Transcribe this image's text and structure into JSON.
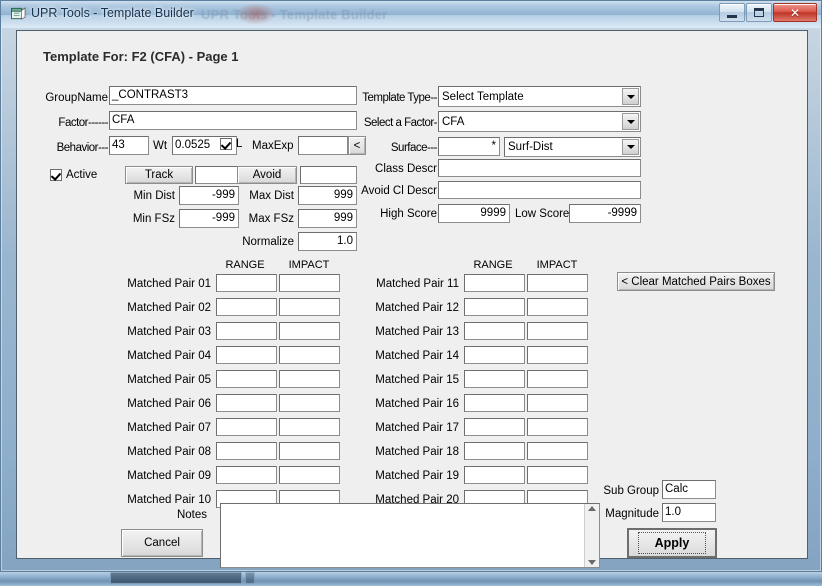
{
  "window": {
    "title": "UPR Tools - Template Builder",
    "icon": "app-window-icon",
    "ghost_title": "UPR Tools - Template Builder",
    "buttons": {
      "minimize": "minimize-icon",
      "maximize": "maximize-icon",
      "close": "✕"
    }
  },
  "page_title": "Template For: F2 (CFA) - Page 1",
  "left_panel": {
    "groupname_label": "GroupName",
    "groupname_value": "_CONTRAST3",
    "factor_label": "Factor------",
    "factor_value": "CFA",
    "behavior_label": "Behavior---",
    "behavior_value": "43",
    "wt_label": "Wt",
    "wt_value": "0.0525",
    "l_checkbox_checked": true,
    "l_label": "L",
    "maxexp_label": "MaxExp",
    "maxexp_value": "",
    "maxexp_button": "<",
    "active_label": "Active",
    "active_checked": true,
    "track_button": "Track",
    "track_value": "",
    "min_dist_label": "Min Dist",
    "min_dist_value": "-999",
    "min_fsz_label": "Min FSz",
    "min_fsz_value": "-999",
    "avoid_button": "Avoid",
    "avoid_value": "",
    "max_dist_label": "Max Dist",
    "max_dist_value": "999",
    "max_fsz_label": "Max FSz",
    "max_fsz_value": "999",
    "normalize_label": "Normalize",
    "normalize_value": "1.0"
  },
  "right_panel": {
    "template_type_label": "Template Type--",
    "template_type_value": "Select Template",
    "select_factor_label": "Select a Factor-",
    "select_factor_value": "CFA",
    "surface_label": "Surface---",
    "surface_value": "*",
    "surface_mode_value": "Surf-Dist",
    "class_descr_label": "Class Descr",
    "class_descr_value": "",
    "avoid_cl_descr_label": "Avoid Cl Descr",
    "avoid_cl_descr_value": "",
    "high_score_label": "High Score",
    "high_score_value": "9999",
    "low_score_label": "Low Score",
    "low_score_value": "-9999"
  },
  "matched_pairs": {
    "col_headers": [
      "RANGE",
      "IMPACT"
    ],
    "clear_button": "< Clear Matched Pairs Boxes",
    "left_rows": [
      {
        "label": "Matched Pair 01",
        "range": "",
        "impact": ""
      },
      {
        "label": "Matched Pair 02",
        "range": "",
        "impact": ""
      },
      {
        "label": "Matched Pair 03",
        "range": "",
        "impact": ""
      },
      {
        "label": "Matched Pair 04",
        "range": "",
        "impact": ""
      },
      {
        "label": "Matched Pair 05",
        "range": "",
        "impact": ""
      },
      {
        "label": "Matched Pair 06",
        "range": "",
        "impact": ""
      },
      {
        "label": "Matched Pair 07",
        "range": "",
        "impact": ""
      },
      {
        "label": "Matched Pair 08",
        "range": "",
        "impact": ""
      },
      {
        "label": "Matched Pair 09",
        "range": "",
        "impact": ""
      },
      {
        "label": "Matched Pair 10",
        "range": "",
        "impact": ""
      }
    ],
    "right_rows": [
      {
        "label": "Matched Pair 11",
        "range": "",
        "impact": ""
      },
      {
        "label": "Matched Pair 12",
        "range": "",
        "impact": ""
      },
      {
        "label": "Matched Pair 13",
        "range": "",
        "impact": ""
      },
      {
        "label": "Matched Pair 14",
        "range": "",
        "impact": ""
      },
      {
        "label": "Matched Pair 15",
        "range": "",
        "impact": ""
      },
      {
        "label": "Matched Pair 16",
        "range": "",
        "impact": ""
      },
      {
        "label": "Matched Pair 17",
        "range": "",
        "impact": ""
      },
      {
        "label": "Matched Pair 18",
        "range": "",
        "impact": ""
      },
      {
        "label": "Matched Pair 19",
        "range": "",
        "impact": ""
      },
      {
        "label": "Matched Pair 20",
        "range": "",
        "impact": ""
      }
    ]
  },
  "footer": {
    "notes_label": "Notes",
    "notes_value": "",
    "cancel_button": "Cancel",
    "sub_group_label": "Sub Group",
    "sub_group_value": "Calc",
    "magnitude_label": "Magnitude",
    "magnitude_value": "1.0",
    "apply_button": "Apply"
  },
  "colors": {
    "client_bg": "#efefef",
    "field_bg": "#ffffff",
    "close_red": "#bf3426",
    "title_text": "#17344f"
  }
}
